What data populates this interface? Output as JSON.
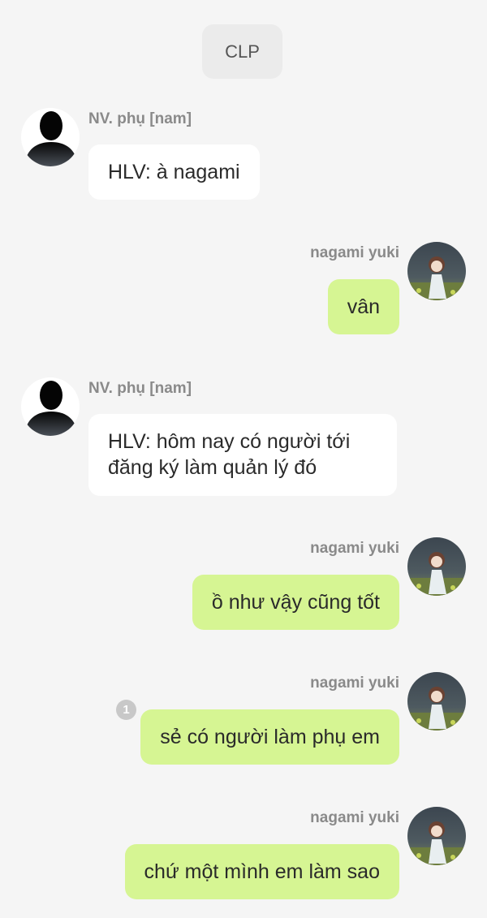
{
  "header": {
    "title": "CLP"
  },
  "messages": [
    {
      "side": "left",
      "sender": "NV. phụ [nam]",
      "text": "HLV: à nagami",
      "avatar_icon": "silhouette-avatar-icon"
    },
    {
      "side": "right",
      "sender": "nagami yuki",
      "text": "vân",
      "avatar_icon": "anime-girl-avatar-icon"
    },
    {
      "side": "left",
      "sender": "NV. phụ [nam]",
      "text_lines": [
        "HLV: hôm nay có người tới",
        "đăng ký làm quản lý đó"
      ],
      "avatar_icon": "silhouette-avatar-icon"
    },
    {
      "side": "right",
      "sender": "nagami yuki",
      "text": "ồ như vậy cũng tốt",
      "avatar_icon": "anime-girl-avatar-icon"
    },
    {
      "side": "right",
      "sender": "nagami yuki",
      "text": "sẻ có người làm phụ em",
      "unread_count": "1",
      "avatar_icon": "anime-girl-avatar-icon"
    },
    {
      "side": "right",
      "sender": "nagami yuki",
      "text": "chứ một mình em làm sao",
      "avatar_icon": "anime-girl-avatar-icon"
    }
  ],
  "colors": {
    "background": "#f5f5f5",
    "left_bubble": "#ffffff",
    "right_bubble": "#d6f593",
    "header_chip": "#ebebeb"
  }
}
